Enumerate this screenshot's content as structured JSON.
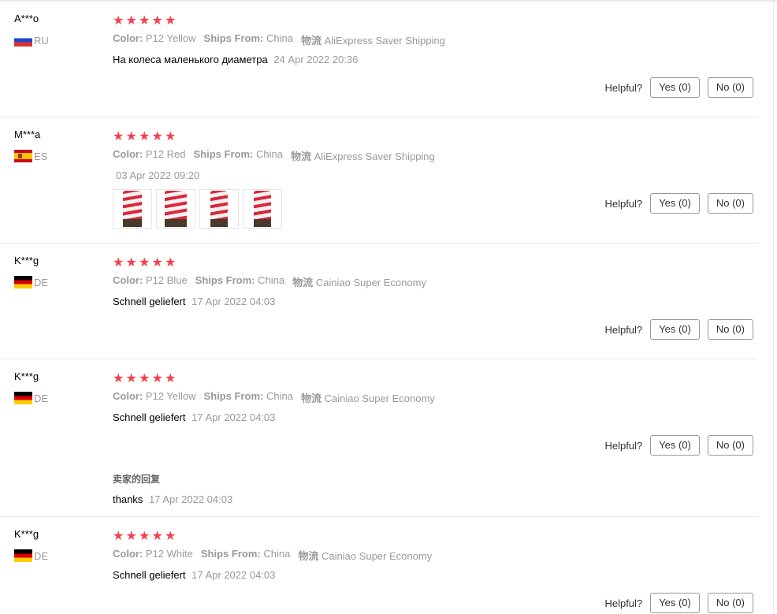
{
  "labels": {
    "color": "Color:",
    "ships_from": "Ships From:",
    "logistics": "物流",
    "helpful": "Helpful?",
    "seller_reply": "卖家的回复"
  },
  "reviews": [
    {
      "user": "A***o",
      "country": "RU",
      "rating": 5,
      "color": "P12 Yellow",
      "ships_from": "China",
      "logistics": "AliExpress Saver Shipping",
      "text": "На колеса маленького диаметра",
      "date": "24 Apr 2022 20:36",
      "yes": "Yes (0)",
      "no": "No (0)"
    },
    {
      "user": "M***a",
      "country": "ES",
      "rating": 5,
      "color": "P12 Red",
      "ships_from": "China",
      "logistics": "AliExpress Saver Shipping",
      "text": "",
      "date": "03 Apr 2022 09:20",
      "yes": "Yes (0)",
      "no": "No (0)"
    },
    {
      "user": "K***g",
      "country": "DE",
      "rating": 5,
      "color": "P12 Blue",
      "ships_from": "China",
      "logistics": "Cainiao Super Economy",
      "text": "Schnell geliefert",
      "date": "17 Apr 2022 04:03",
      "yes": "Yes (0)",
      "no": "No (0)"
    },
    {
      "user": "K***g",
      "country": "DE",
      "rating": 5,
      "color": "P12 Yellow",
      "ships_from": "China",
      "logistics": "Cainiao Super Economy",
      "text": "Schnell geliefert",
      "date": "17 Apr 2022 04:03",
      "yes": "Yes (0)",
      "no": "No (0)",
      "reply_text": "thanks",
      "reply_date": "17 Apr 2022 04:03"
    },
    {
      "user": "K***g",
      "country": "DE",
      "rating": 5,
      "color": "P12 White",
      "ships_from": "China",
      "logistics": "Cainiao Super Economy",
      "text": "Schnell geliefert",
      "date": "17 Apr 2022 04:03",
      "yes": "Yes (0)",
      "no": "No (0)"
    }
  ],
  "colors": {
    "star": "#f5404b",
    "muted": "#999999",
    "border": "#e8e8e8"
  }
}
